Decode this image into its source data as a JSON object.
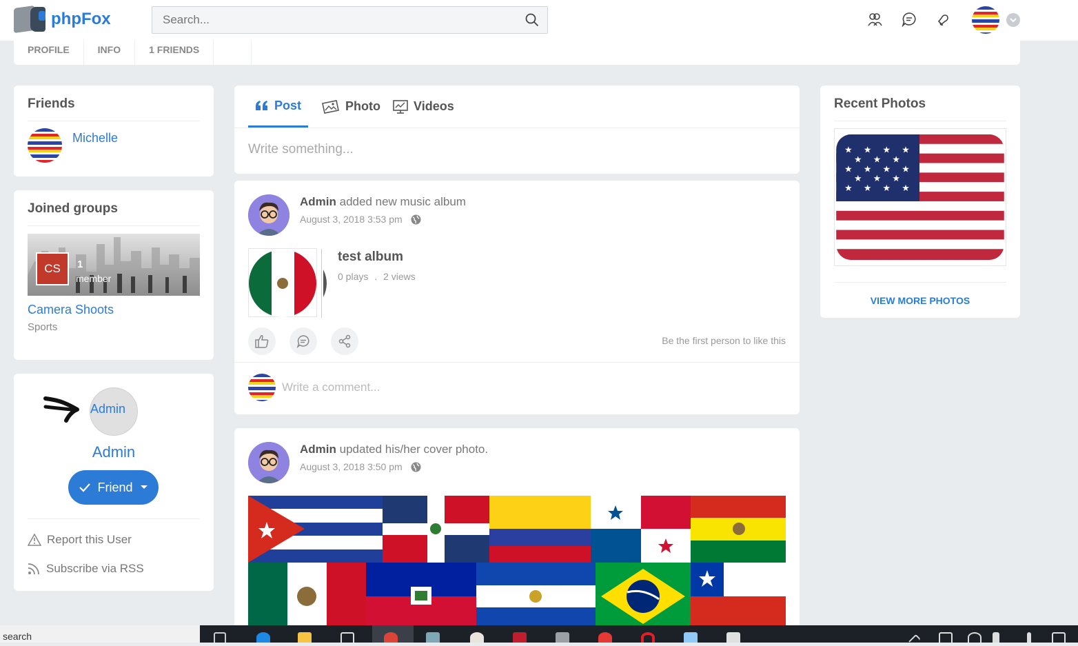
{
  "app": {
    "logo_text": "phpFox"
  },
  "search": {
    "placeholder": "Search..."
  },
  "profile_tabs": [
    "PROFILE",
    "INFO",
    "1 FRIENDS"
  ],
  "friends": {
    "title": "Friends",
    "items": [
      {
        "name": "Michelle"
      }
    ]
  },
  "groups": {
    "title": "Joined groups",
    "items": [
      {
        "initials": "CS",
        "member_count": "1",
        "member_label": "member",
        "name": "Camera Shoots",
        "category": "Sports"
      }
    ]
  },
  "profile": {
    "avatar_alt": "Admin",
    "name": "Admin",
    "friend_button": "Friend",
    "actions": [
      "Report this User",
      "Subscribe via RSS"
    ]
  },
  "composer": {
    "tabs": [
      "Post",
      "Photo",
      "Videos"
    ],
    "placeholder": "Write something..."
  },
  "feed": [
    {
      "author": "Admin",
      "action": "added new music album",
      "date": "August 3, 2018 3:53 pm",
      "album": {
        "title": "test album",
        "plays": "0 plays",
        "separator": ".",
        "views": "2 views"
      },
      "likes_note": "Be the first person to like this",
      "comment_placeholder": "Write a comment..."
    },
    {
      "author": "Admin",
      "action": "updated his/her cover photo.",
      "date": "August 3, 2018 3:50 pm"
    }
  ],
  "recent_photos": {
    "title": "Recent Photos",
    "view_more": "VIEW MORE PHOTOS"
  },
  "taskbar": {
    "search_text": "search"
  },
  "colors": {
    "accent": "#2c7bd6",
    "page_bg": "#e9ecef"
  }
}
